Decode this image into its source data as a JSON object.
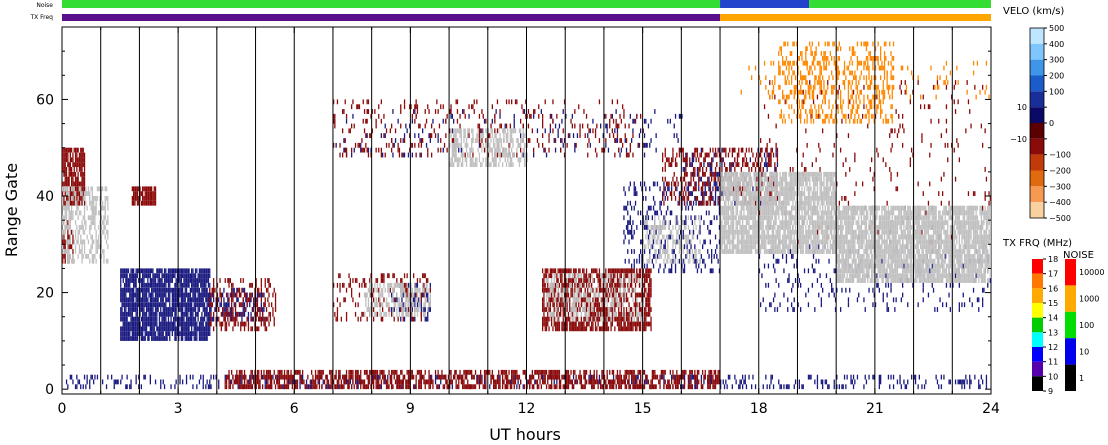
{
  "chart_data": {
    "type": "heatmap",
    "title": "",
    "xlabel": "UT hours",
    "ylabel": "Range Gate",
    "xlim": [
      0,
      24
    ],
    "ylim": [
      -1,
      75
    ],
    "x_ticks": [
      0,
      3,
      6,
      9,
      12,
      15,
      18,
      21,
      24
    ],
    "y_ticks": [
      0,
      20,
      40,
      60
    ],
    "grid": "vertical lines every 1 UT hour",
    "status_bars": [
      {
        "label": "Noise",
        "segments": [
          {
            "start": 0,
            "end": 17,
            "color": "#33dd33"
          },
          {
            "start": 17,
            "end": 19.3,
            "color": "#2244cc"
          },
          {
            "start": 19.3,
            "end": 24,
            "color": "#33dd33"
          }
        ]
      },
      {
        "label": "TX Freq",
        "segments": [
          {
            "start": 0,
            "end": 17,
            "color": "#5c0f8c"
          },
          {
            "start": 17,
            "end": 24,
            "color": "#ffa500"
          }
        ]
      }
    ],
    "velocity_scale": {
      "title": "VELO (km/s)",
      "ticks": [
        "500",
        "400",
        "300",
        "200",
        "100",
        "10",
        "0",
        "−10",
        "−100",
        "−200",
        "−300",
        "−400",
        "−500"
      ]
    },
    "frequency_scale": {
      "title": "TX FRQ (MHz)",
      "ticks": [
        "18",
        "17",
        "16",
        "15",
        "14",
        "13",
        "12",
        "11",
        "10",
        "9"
      ],
      "colors": [
        "#ff0000",
        "#ff7700",
        "#ffaa00",
        "#ffff00",
        "#00cc00",
        "#00ffff",
        "#0000ff",
        "#5500aa",
        "#000000"
      ]
    },
    "noise_scale": {
      "title": "NOISE",
      "ticks": [
        "10000",
        "1000",
        "100",
        "10",
        "1"
      ],
      "colors": [
        "#ff0000",
        "#ffaa00",
        "#00dd00",
        "#0000ee",
        "#000000"
      ]
    },
    "series": [
      {
        "color": "#1a1a80",
        "regions": [
          {
            "x": [
              1.5,
              3.8
            ],
            "y": [
              10,
              25
            ],
            "density": 0.85
          },
          {
            "x": [
              3.8,
              5.2
            ],
            "y": [
              14,
              21
            ],
            "density": 0.35
          },
          {
            "x": [
              8.5,
              9.5
            ],
            "y": [
              14,
              22
            ],
            "density": 0.3
          },
          {
            "x": [
              0.0,
              24.0
            ],
            "y": [
              0,
              3
            ],
            "density": 0.22
          },
          {
            "x": [
              14.5,
              17.0
            ],
            "y": [
              24,
              43
            ],
            "density": 0.2
          },
          {
            "x": [
              16.0,
              18.5
            ],
            "y": [
              38,
              50
            ],
            "density": 0.15
          },
          {
            "x": [
              7.0,
              16.0
            ],
            "y": [
              48,
              58
            ],
            "density": 0.06
          },
          {
            "x": [
              18.0,
              24.0
            ],
            "y": [
              16,
              30
            ],
            "density": 0.1
          }
        ]
      },
      {
        "color": "#8b0a0a",
        "regions": [
          {
            "x": [
              0.0,
              0.6
            ],
            "y": [
              38,
              50
            ],
            "density": 0.8
          },
          {
            "x": [
              0.0,
              0.3
            ],
            "y": [
              26,
              35
            ],
            "density": 0.6
          },
          {
            "x": [
              1.8,
              2.4
            ],
            "y": [
              38,
              42
            ],
            "density": 0.8
          },
          {
            "x": [
              3.8,
              5.5
            ],
            "y": [
              12,
              23
            ],
            "density": 0.35
          },
          {
            "x": [
              7.0,
              9.5
            ],
            "y": [
              14,
              24
            ],
            "density": 0.2
          },
          {
            "x": [
              12.4,
              15.2
            ],
            "y": [
              12,
              25
            ],
            "density": 0.7
          },
          {
            "x": [
              4.2,
              17.0
            ],
            "y": [
              0,
              4
            ],
            "density": 0.55
          },
          {
            "x": [
              7.0,
              15.0
            ],
            "y": [
              48,
              60
            ],
            "density": 0.12
          },
          {
            "x": [
              15.5,
              18.5
            ],
            "y": [
              38,
              50
            ],
            "density": 0.3
          },
          {
            "x": [
              18.0,
              24.0
            ],
            "y": [
              30,
              64
            ],
            "density": 0.04
          }
        ]
      },
      {
        "color": "#c0c0c0",
        "regions": [
          {
            "x": [
              0.0,
              1.2
            ],
            "y": [
              26,
              42
            ],
            "density": 0.45
          },
          {
            "x": [
              7.8,
              9.5
            ],
            "y": [
              15,
              22
            ],
            "density": 0.45
          },
          {
            "x": [
              12.5,
              15.0
            ],
            "y": [
              14,
              24
            ],
            "density": 0.3
          },
          {
            "x": [
              10.0,
              12.0
            ],
            "y": [
              46,
              54
            ],
            "density": 0.45
          },
          {
            "x": [
              15.0,
              16.5
            ],
            "y": [
              26,
              36
            ],
            "density": 0.4
          },
          {
            "x": [
              17.0,
              20.0
            ],
            "y": [
              28,
              45
            ],
            "density": 0.85
          },
          {
            "x": [
              20.0,
              24.0
            ],
            "y": [
              22,
              38
            ],
            "density": 0.85
          }
        ]
      },
      {
        "color": "#ff8800",
        "regions": [
          {
            "x": [
              18.5,
              21.5
            ],
            "y": [
              55,
              72
            ],
            "density": 0.3
          },
          {
            "x": [
              17.5,
              24.0
            ],
            "y": [
              60,
              68
            ],
            "density": 0.06
          }
        ]
      }
    ]
  }
}
